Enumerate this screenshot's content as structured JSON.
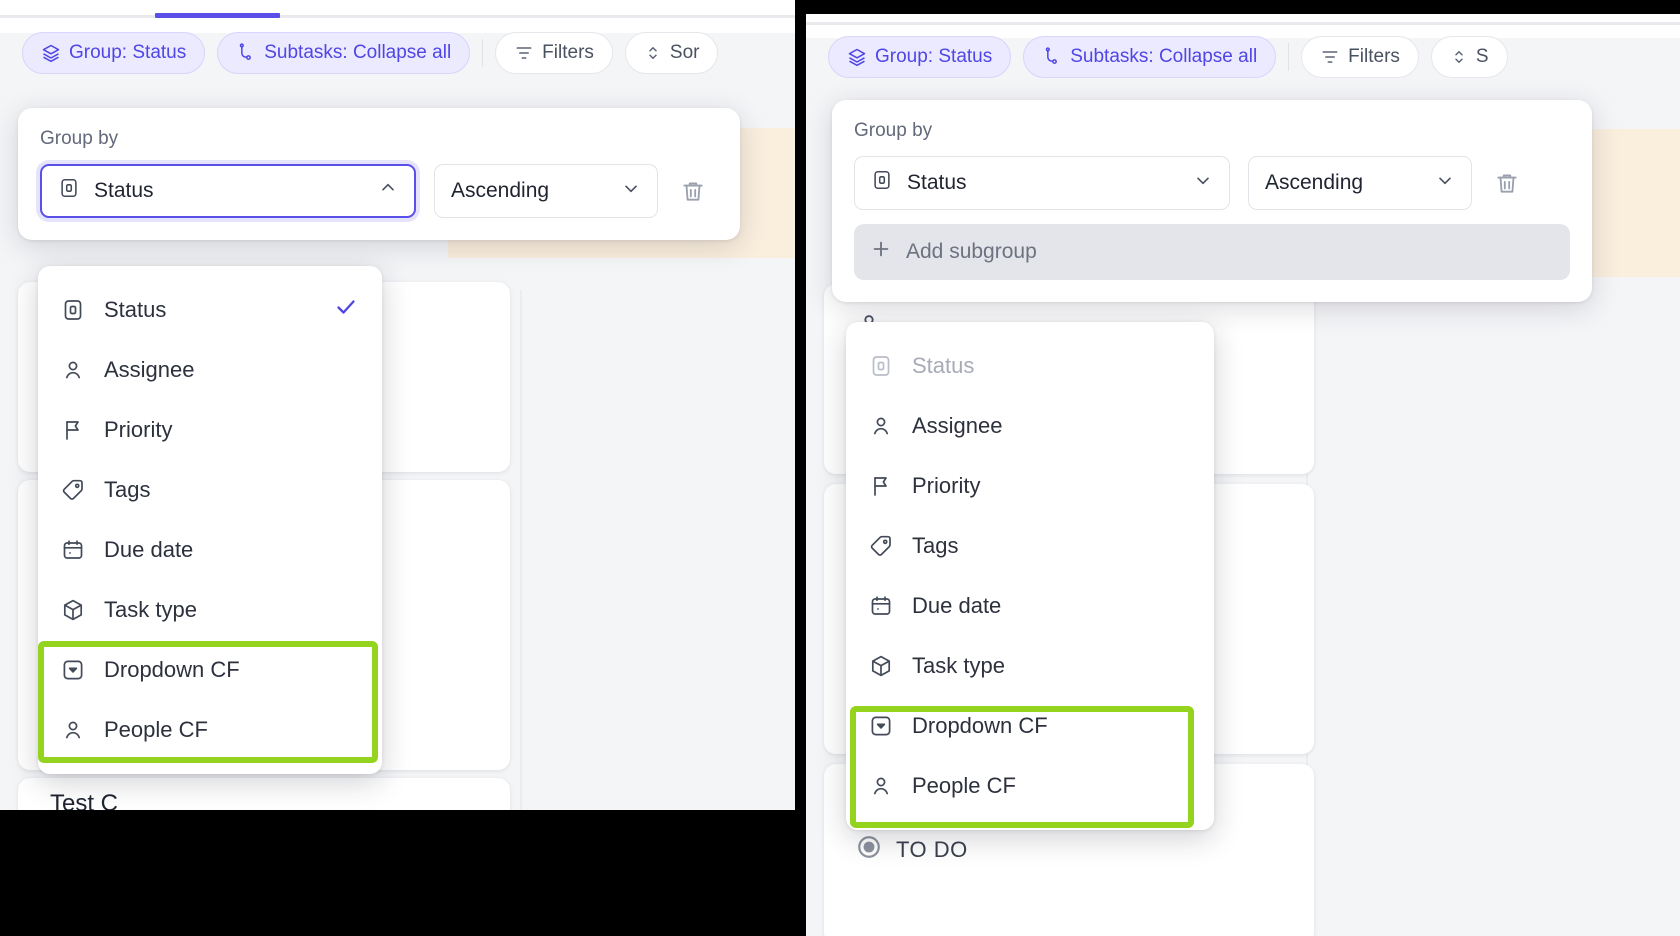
{
  "meta": {
    "accent_purple": "#5a4fe8",
    "annotation_green": "#94d31e",
    "chip_bg": "#eceaff",
    "cream_strip": "#faeedd"
  },
  "left_panel": {
    "toolbar": {
      "group_chip": "Group: Status",
      "subtasks_chip": "Subtasks: Collapse all",
      "filters_chip": "Filters",
      "sort_chip": "Sor"
    },
    "popover": {
      "label": "Group by",
      "group_field": "Status",
      "sort_order": "Ascending",
      "chevron_group": "chevron-up",
      "chevron_order": "chevron-down"
    },
    "menu": {
      "items": [
        {
          "label": "Status",
          "icon": "status-icon",
          "checked": true,
          "disabled": false
        },
        {
          "label": "Assignee",
          "icon": "person-icon",
          "checked": false,
          "disabled": false
        },
        {
          "label": "Priority",
          "icon": "flag-icon",
          "checked": false,
          "disabled": false
        },
        {
          "label": "Tags",
          "icon": "tag-icon",
          "checked": false,
          "disabled": false
        },
        {
          "label": "Due date",
          "icon": "calendar-icon",
          "checked": false,
          "disabled": false
        },
        {
          "label": "Task type",
          "icon": "cube-icon",
          "checked": false,
          "disabled": false
        },
        {
          "label": "Dropdown CF",
          "icon": "dropdown-icon",
          "checked": false,
          "disabled": false
        },
        {
          "label": "People CF",
          "icon": "person-icon",
          "checked": false,
          "disabled": false
        }
      ]
    },
    "board": {
      "task_title": "Test C"
    }
  },
  "right_panel": {
    "toolbar": {
      "group_chip": "Group: Status",
      "subtasks_chip": "Subtasks: Collapse all",
      "filters_chip": "Filters",
      "sort_chip": "S"
    },
    "popover": {
      "label": "Group by",
      "group_field": "Status",
      "sort_order": "Ascending",
      "chevron_group": "chevron-down",
      "chevron_order": "chevron-down",
      "add_subgroup": "Add subgroup"
    },
    "menu": {
      "items": [
        {
          "label": "Status",
          "icon": "status-icon",
          "checked": false,
          "disabled": true
        },
        {
          "label": "Assignee",
          "icon": "person-icon",
          "checked": false,
          "disabled": false
        },
        {
          "label": "Priority",
          "icon": "flag-icon",
          "checked": false,
          "disabled": false
        },
        {
          "label": "Tags",
          "icon": "tag-icon",
          "checked": false,
          "disabled": false
        },
        {
          "label": "Due date",
          "icon": "calendar-icon",
          "checked": false,
          "disabled": false
        },
        {
          "label": "Task type",
          "icon": "cube-icon",
          "checked": false,
          "disabled": false
        },
        {
          "label": "Dropdown CF",
          "icon": "dropdown-icon",
          "checked": false,
          "disabled": false
        },
        {
          "label": "People CF",
          "icon": "person-icon",
          "checked": false,
          "disabled": false
        }
      ]
    },
    "board": {
      "group_placeholder": "-",
      "status_group": "TO DO"
    }
  }
}
